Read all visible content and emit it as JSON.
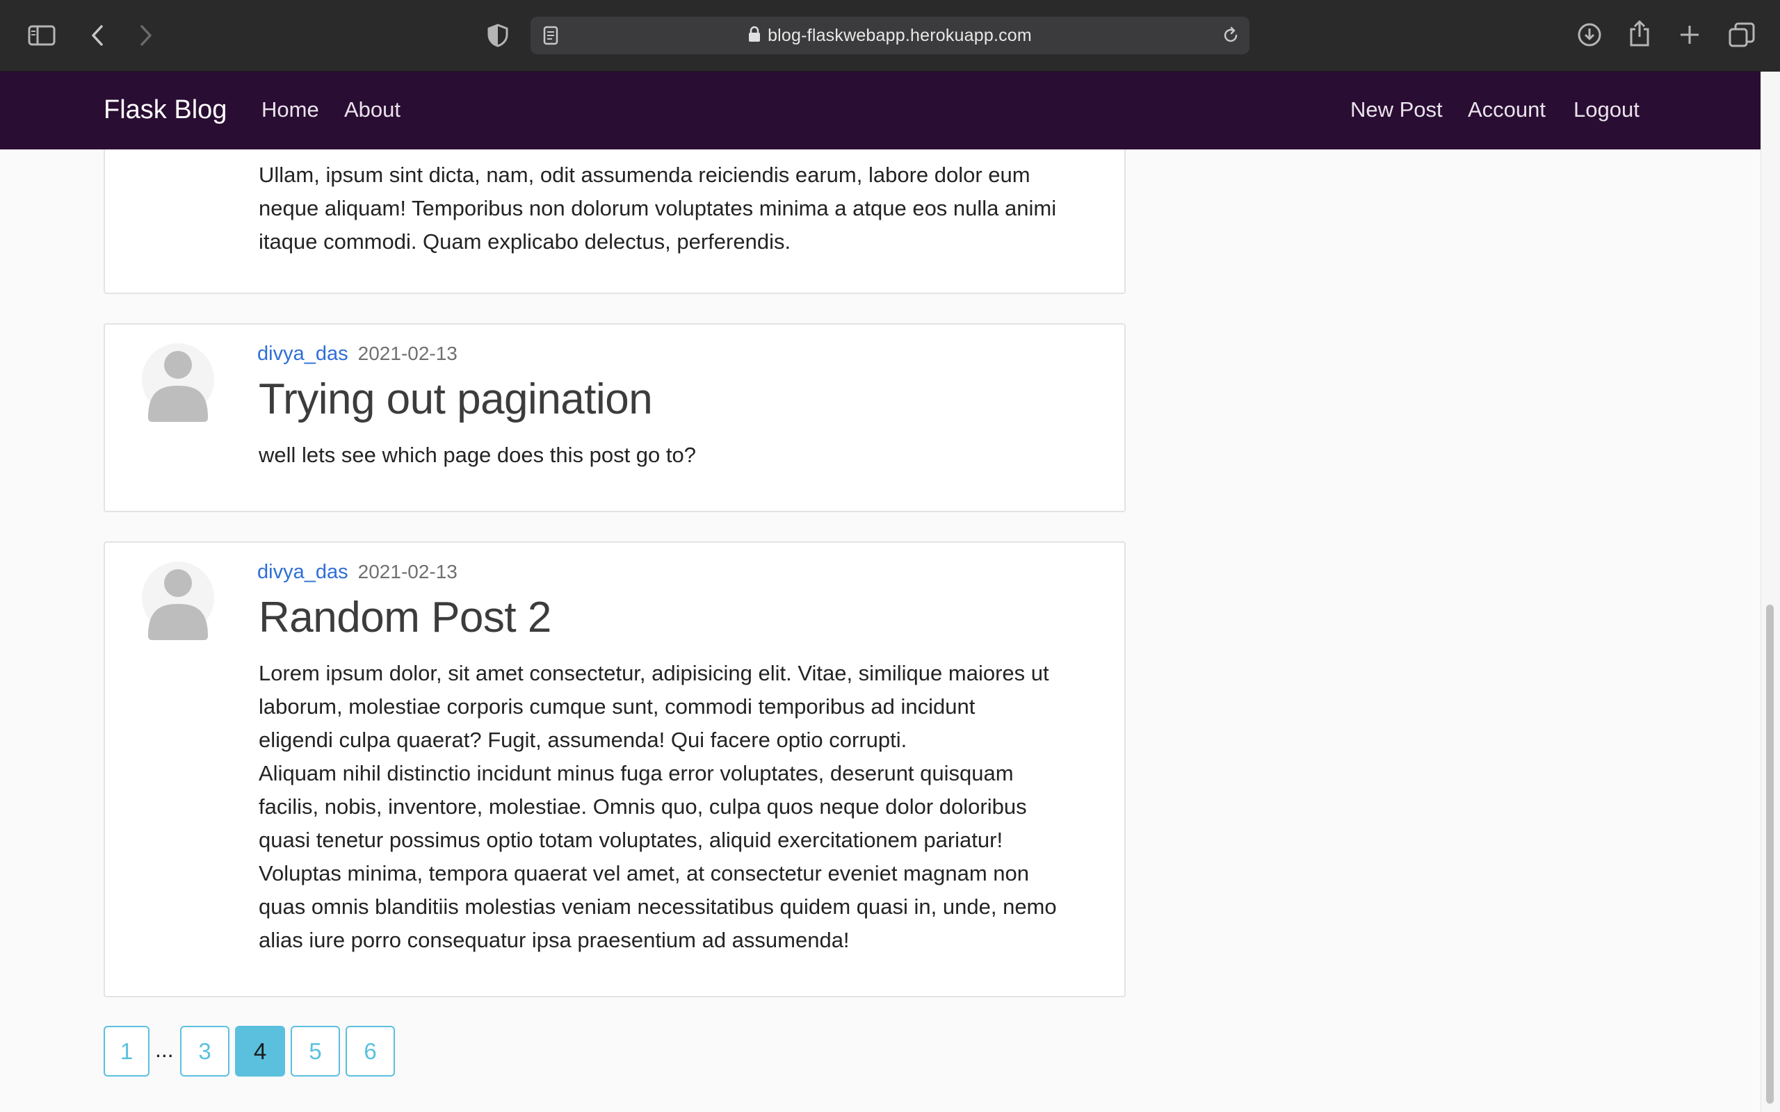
{
  "browser": {
    "url": "blog-flaskwebapp.herokuapp.com",
    "icons": [
      "sidebar-icon",
      "back-icon",
      "forward-icon",
      "shield-icon",
      "reader-icon",
      "lock-icon",
      "reload-icon",
      "download-icon",
      "share-icon",
      "new-tab-icon",
      "tabs-overview-icon"
    ]
  },
  "navbar": {
    "brand": "Flask Blog",
    "left_links": [
      "Home",
      "About"
    ],
    "right_links": [
      "New Post",
      "Account",
      "Logout"
    ],
    "bg_color": "#2a0d33"
  },
  "posts": [
    {
      "body": "Ullam, ipsum sint dicta, nam, odit assumenda reiciendis earum, labore dolor eum\nneque aliquam! Temporibus non dolorum voluptates minima a atque eos nulla animi\nitaque commodi. Quam explicabo delectus, perferendis."
    },
    {
      "author": "divya_das",
      "date": "2021-02-13",
      "title": "Trying out pagination",
      "body": "well lets see which page does this post go to?"
    },
    {
      "author": "divya_das",
      "date": "2021-02-13",
      "title": "Random Post 2",
      "body": "Lorem ipsum dolor, sit amet consectetur, adipisicing elit. Vitae, similique maiores ut\nlaborum, molestiae corporis cumque sunt, commodi temporibus ad incidunt\neligendi culpa quaerat? Fugit, assumenda! Qui facere optio corrupti.\nAliquam nihil distinctio incidunt minus fuga error voluptates, deserunt quisquam\nfacilis, nobis, inventore, molestiae. Omnis quo, culpa quos neque dolor doloribus\nquasi tenetur possimus optio totam voluptates, aliquid exercitationem pariatur!\nVoluptas minima, tempora quaerat vel amet, at consectetur eveniet magnam non\nquas omnis blanditiis molestias veniam necessitatibus quidem quasi in, unde, nemo\nalias iure porro consequatur ipsa praesentium ad assumenda!"
    }
  ],
  "pagination": {
    "pages": [
      "1",
      "3",
      "4",
      "5",
      "6"
    ],
    "ellipsis": "...",
    "current": "4",
    "accent_color": "#5bc0de"
  },
  "colors": {
    "author_link": "#2f6fd6",
    "page_bg": "#fafafa"
  }
}
